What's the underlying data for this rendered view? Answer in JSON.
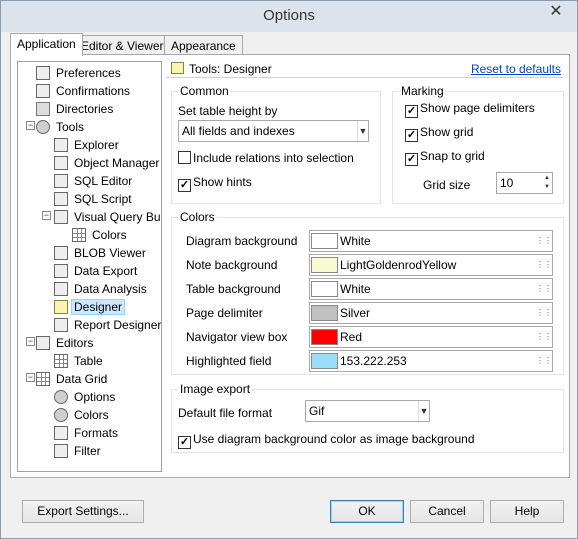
{
  "window": {
    "title": "Options",
    "close": "✕"
  },
  "tabs": [
    {
      "label": "Application",
      "active": true
    },
    {
      "label": "Editor & Viewers",
      "active": false
    },
    {
      "label": "Appearance",
      "active": false
    }
  ],
  "tree": [
    {
      "label": "Preferences",
      "icon": "preferences-icon"
    },
    {
      "label": "Confirmations",
      "icon": "confirmations-icon"
    },
    {
      "label": "Directories",
      "icon": "folder-icon"
    },
    {
      "label": "Tools",
      "icon": "tools-icon",
      "expanded": true
    },
    {
      "label": "Explorer",
      "icon": "explorer-icon"
    },
    {
      "label": "Object Manager",
      "icon": "object-manager-icon"
    },
    {
      "label": "SQL Editor",
      "icon": "sql-editor-icon"
    },
    {
      "label": "SQL Script",
      "icon": "sql-script-icon"
    },
    {
      "label": "Visual Query Builder",
      "icon": "query-builder-icon",
      "expanded": true
    },
    {
      "label": "Colors",
      "icon": "grid-icon"
    },
    {
      "label": "BLOB Viewer",
      "icon": "blob-viewer-icon"
    },
    {
      "label": "Data Export",
      "icon": "data-export-icon"
    },
    {
      "label": "Data Analysis",
      "icon": "data-analysis-icon"
    },
    {
      "label": "Designer",
      "icon": "designer-icon",
      "selected": true
    },
    {
      "label": "Report Designer",
      "icon": "report-designer-icon"
    },
    {
      "label": "Editors",
      "icon": "editors-icon",
      "expanded": true
    },
    {
      "label": "Table",
      "icon": "grid-icon"
    },
    {
      "label": "Data Grid",
      "icon": "grid-icon",
      "expanded": true
    },
    {
      "label": "Options",
      "icon": "gear-icon"
    },
    {
      "label": "Colors",
      "icon": "gear-icon"
    },
    {
      "label": "Formats",
      "icon": "formats-icon"
    },
    {
      "label": "Filter",
      "icon": "filter-icon"
    }
  ],
  "header": {
    "title": "Tools: Designer",
    "reset": "Reset to defaults"
  },
  "common": {
    "group_label": "Common",
    "table_height_label": "Set table height by",
    "table_height_value": "All fields and indexes",
    "include_relations": "Include relations into selection",
    "include_relations_checked": false,
    "show_hints": "Show hints",
    "show_hints_checked": true
  },
  "marking": {
    "group_label": "Marking",
    "show_delimiters": "Show page delimiters",
    "show_grid": "Show grid",
    "snap_to_grid": "Snap to grid",
    "grid_size_label": "Grid size",
    "grid_size_value": "10"
  },
  "colors": {
    "group_label": "Colors",
    "rows": [
      {
        "label": "Diagram background",
        "name": "White",
        "swatch": "#ffffff"
      },
      {
        "label": "Note background",
        "name": "LightGoldenrodYellow",
        "swatch": "#fafad2"
      },
      {
        "label": "Table background",
        "name": "White",
        "swatch": "#ffffff"
      },
      {
        "label": "Page delimiter",
        "name": "Silver",
        "swatch": "#c0c0c0"
      },
      {
        "label": "Navigator view box",
        "name": "Red",
        "swatch": "#ff0000"
      },
      {
        "label": "Highlighted field",
        "name": "153.222.253",
        "swatch": "#99defd"
      }
    ]
  },
  "image_export": {
    "group_label": "Image export",
    "format_label": "Default file format",
    "format_value": "Gif",
    "use_bg": "Use diagram background color as image background"
  },
  "buttons": {
    "export": "Export Settings...",
    "ok": "OK",
    "cancel": "Cancel",
    "help": "Help"
  }
}
